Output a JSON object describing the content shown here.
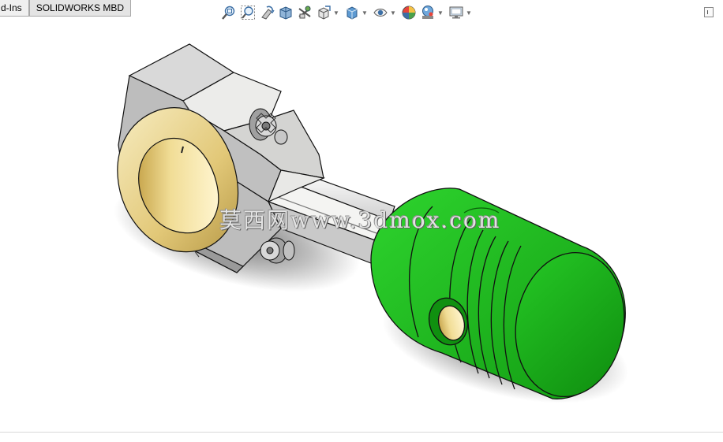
{
  "command_tabs": [
    {
      "label": "d-Ins",
      "active": false
    },
    {
      "label": "SOLIDWORKS MBD",
      "active": true
    }
  ],
  "heads_up_toolbar": {
    "items": [
      {
        "icon": "zoom-to-fit-icon",
        "dropdown": false
      },
      {
        "icon": "zoom-to-area-icon",
        "dropdown": false
      },
      {
        "icon": "previous-view-icon",
        "dropdown": false
      },
      {
        "icon": "section-view-icon",
        "dropdown": false
      },
      {
        "icon": "dynamic-annotation-views-icon",
        "dropdown": false
      },
      {
        "icon": "view-orientation-icon",
        "dropdown": true
      },
      {
        "icon": "display-style-icon",
        "dropdown": true
      },
      {
        "icon": "hide-show-items-icon",
        "dropdown": true
      },
      {
        "icon": "edit-appearance-icon",
        "dropdown": false
      },
      {
        "icon": "apply-scene-icon",
        "dropdown": true
      },
      {
        "icon": "view-settings-icon",
        "dropdown": true
      }
    ]
  },
  "model": {
    "name": "connecting-rod-piston-assembly",
    "colors": {
      "piston": "#1cbe1c",
      "rod": "#f2f2f0",
      "bushing": "#e8d490",
      "outline": "#111111"
    }
  },
  "watermark": {
    "text": "莫西网www.3dmox.com"
  },
  "accent_colors": {
    "tab_border": "#a8a8a8",
    "tab_bg": "#f0f0f0"
  }
}
